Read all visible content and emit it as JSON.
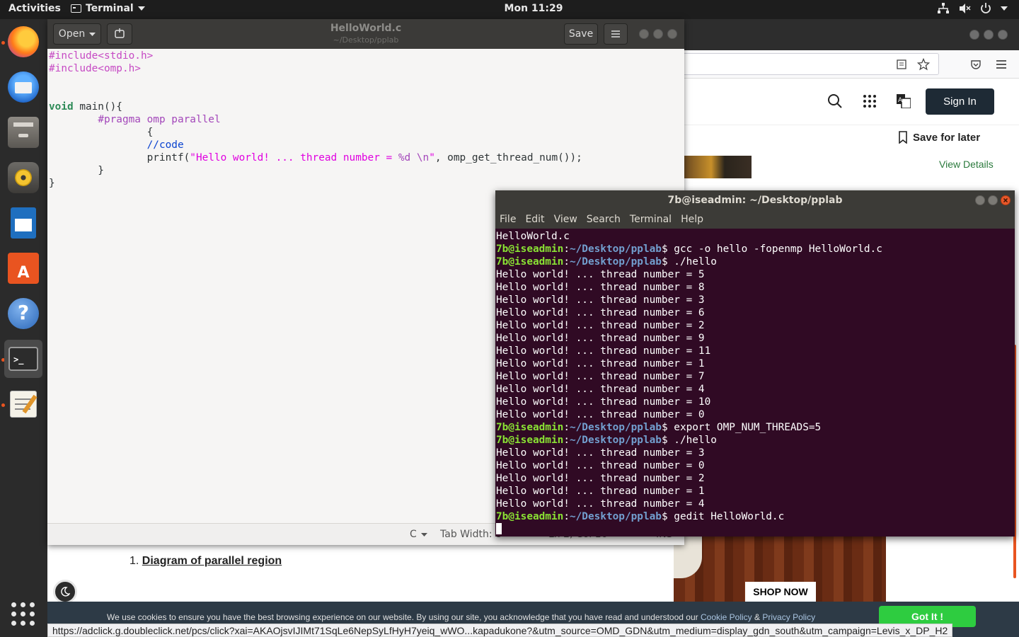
{
  "topbar": {
    "activities": "Activities",
    "app_menu": "Terminal",
    "clock": "Mon 11:29",
    "tray_icons": [
      "network-icon",
      "volume-muted-icon",
      "power-icon",
      "chevron-down-icon"
    ]
  },
  "dock": {
    "items": [
      "firefox-icon",
      "thunderbird-icon",
      "files-icon",
      "rhythmbox-icon",
      "libreoffice-writer-icon",
      "software-center-icon",
      "help-icon",
      "terminal-icon",
      "text-editor-icon"
    ],
    "active": "terminal-icon"
  },
  "gedit": {
    "open_label": "Open",
    "save_label": "Save",
    "title": "HelloWorld.c",
    "subtitle": "~/Desktop/pplab",
    "code": [
      [
        {
          "t": "#include<stdio.h>",
          "c": "k-pre"
        }
      ],
      [
        {
          "t": "#include<omp.h>",
          "c": "k-pre"
        }
      ],
      [],
      [],
      [
        {
          "t": "void",
          "c": "k-kw"
        },
        {
          "t": " main(){",
          "c": ""
        }
      ],
      [
        {
          "t": "        ",
          "c": ""
        },
        {
          "t": "#pragma",
          "c": "k-pp"
        },
        {
          "t": " ",
          "c": ""
        },
        {
          "t": "omp parallel",
          "c": "k-pp"
        }
      ],
      [
        {
          "t": "                {",
          "c": ""
        }
      ],
      [
        {
          "t": "                ",
          "c": ""
        },
        {
          "t": "//code",
          "c": "k-cm"
        }
      ],
      [
        {
          "t": "                printf(",
          "c": ""
        },
        {
          "t": "\"Hello world! ... thread number = ",
          "c": "k-str"
        },
        {
          "t": "%d",
          "c": "k-pp"
        },
        {
          "t": " ",
          "c": "k-str"
        },
        {
          "t": "\\n",
          "c": "k-pp"
        },
        {
          "t": "\"",
          "c": "k-str"
        },
        {
          "t": ", omp_get_thread_num());",
          "c": ""
        }
      ],
      [
        {
          "t": "        }",
          "c": ""
        }
      ],
      [
        {
          "t": "}",
          "c": ""
        }
      ]
    ],
    "status": {
      "language": "C",
      "tab_width": "Tab Width: 8",
      "position": "Ln 2, Col 16",
      "mode": "INS"
    }
  },
  "terminal": {
    "title": "7b@iseadmin: ~/Desktop/pplab",
    "menu": [
      "File",
      "Edit",
      "View",
      "Search",
      "Terminal",
      "Help"
    ],
    "prompt_user": "7b@iseadmin",
    "prompt_path": "~/Desktop/pplab",
    "lines": [
      {
        "type": "out",
        "text": "HelloWorld.c"
      },
      {
        "type": "cmd",
        "text": "gcc -o hello -fopenmp HelloWorld.c"
      },
      {
        "type": "cmd",
        "text": "./hello"
      },
      {
        "type": "out",
        "text": "Hello world! ... thread number = 5"
      },
      {
        "type": "out",
        "text": "Hello world! ... thread number = 8"
      },
      {
        "type": "out",
        "text": "Hello world! ... thread number = 3"
      },
      {
        "type": "out",
        "text": "Hello world! ... thread number = 6"
      },
      {
        "type": "out",
        "text": "Hello world! ... thread number = 2"
      },
      {
        "type": "out",
        "text": "Hello world! ... thread number = 9"
      },
      {
        "type": "out",
        "text": "Hello world! ... thread number = 11"
      },
      {
        "type": "out",
        "text": "Hello world! ... thread number = 1"
      },
      {
        "type": "out",
        "text": "Hello world! ... thread number = 7"
      },
      {
        "type": "out",
        "text": "Hello world! ... thread number = 4"
      },
      {
        "type": "out",
        "text": "Hello world! ... thread number = 10"
      },
      {
        "type": "out",
        "text": "Hello world! ... thread number = 0"
      },
      {
        "type": "cmd",
        "text": "export OMP_NUM_THREADS=5"
      },
      {
        "type": "cmd",
        "text": "./hello"
      },
      {
        "type": "out",
        "text": "Hello world! ... thread number = 3"
      },
      {
        "type": "out",
        "text": "Hello world! ... thread number = 0"
      },
      {
        "type": "out",
        "text": "Hello world! ... thread number = 2"
      },
      {
        "type": "out",
        "text": "Hello world! ... thread number = 1"
      },
      {
        "type": "out",
        "text": "Hello world! ... thread number = 4"
      },
      {
        "type": "cmd",
        "text": "gedit HelloWorld.c"
      },
      {
        "type": "cursor",
        "text": ""
      }
    ]
  },
  "browser": {
    "sign_in": "Sign In",
    "save_for_later": "Save for later",
    "view_details": "View Details",
    "shop_now": "SHOP NOW",
    "article_item_number": "1.",
    "article_item": "Diagram of parallel region",
    "cookie_text": "We use cookies to ensure you have the best browsing experience on our website. By using our site, you acknowledge that you have read and understood our",
    "cookie_policy": "Cookie Policy",
    "cookie_and": "&",
    "privacy_policy": "Privacy Policy",
    "got_it": "Got It !",
    "status_url": "https://adclick.g.doubleclick.net/pcs/click?xai=AKAOjsvIJIMt71SqLe6NepSyLfHyH7yeiq_wWO...kapadukone?&utm_source=OMD_GDN&utm_medium=display_gdn_south&utm_campaign=Levis_x_DP_H2"
  }
}
